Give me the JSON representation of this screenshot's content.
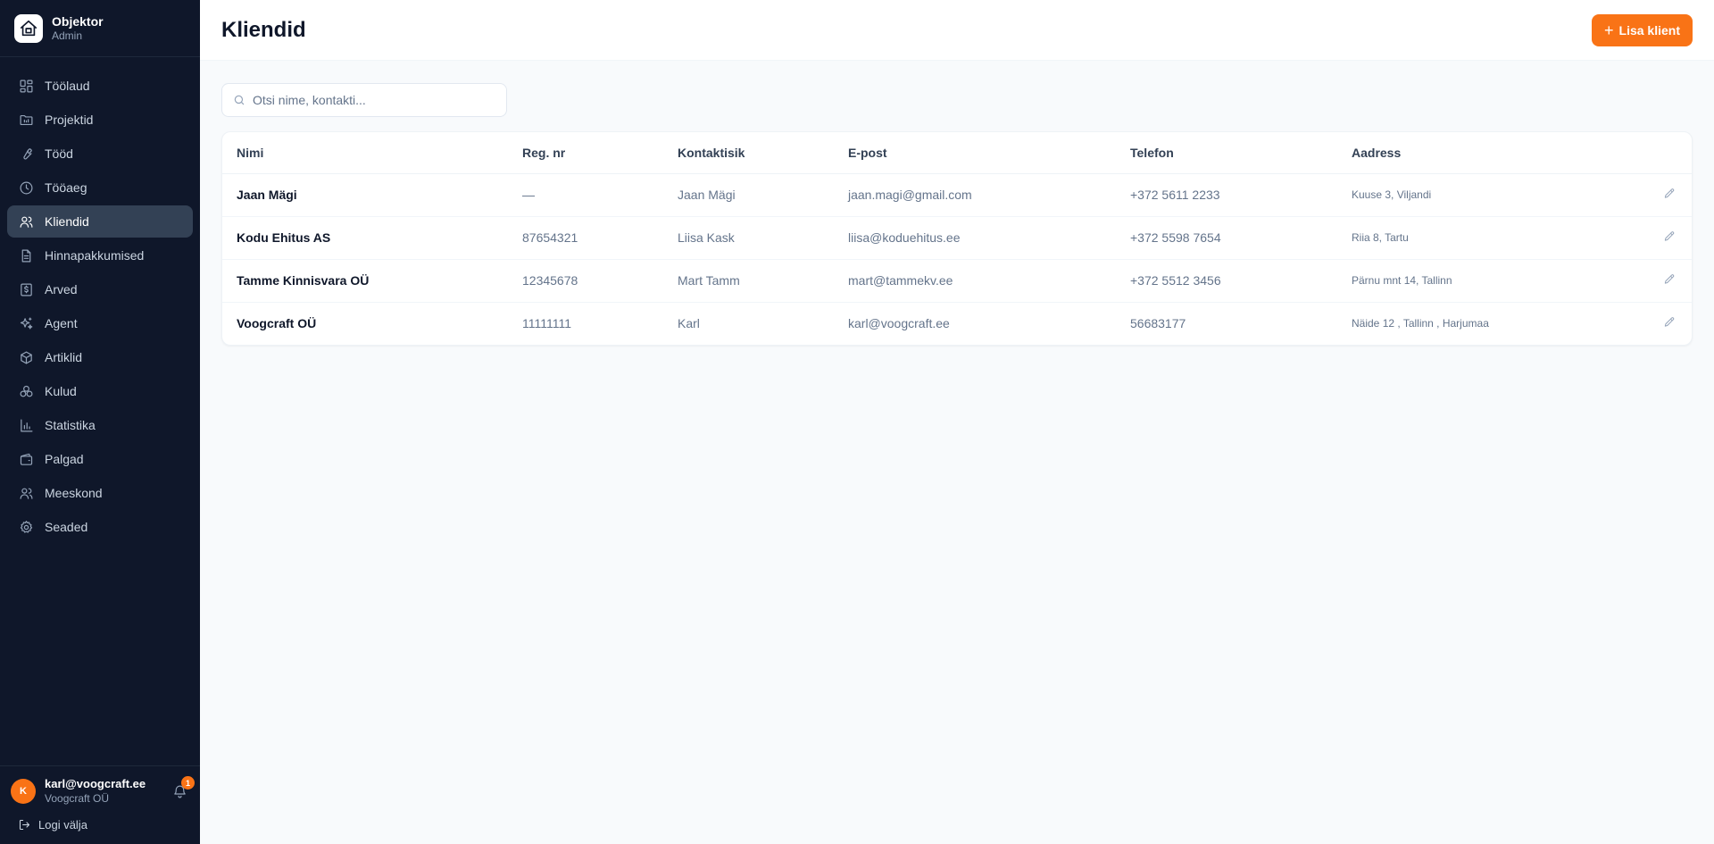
{
  "brand": {
    "name": "Objektor",
    "role": "Admin"
  },
  "nav": [
    {
      "label": "Töölaud",
      "icon": "dashboard-icon",
      "active": false
    },
    {
      "label": "Projektid",
      "icon": "folder-icon",
      "active": false
    },
    {
      "label": "Tööd",
      "icon": "wrench-icon",
      "active": false
    },
    {
      "label": "Tööaeg",
      "icon": "clock-icon",
      "active": false
    },
    {
      "label": "Kliendid",
      "icon": "users-icon",
      "active": true
    },
    {
      "label": "Hinnapakkumised",
      "icon": "document-icon",
      "active": false
    },
    {
      "label": "Arved",
      "icon": "invoice-icon",
      "active": false
    },
    {
      "label": "Agent",
      "icon": "sparkles-icon",
      "active": false
    },
    {
      "label": "Artiklid",
      "icon": "box-icon",
      "active": false
    },
    {
      "label": "Kulud",
      "icon": "coins-icon",
      "active": false
    },
    {
      "label": "Statistika",
      "icon": "bar-chart-icon",
      "active": false
    },
    {
      "label": "Palgad",
      "icon": "wallet-icon",
      "active": false
    },
    {
      "label": "Meeskond",
      "icon": "team-icon",
      "active": false
    },
    {
      "label": "Seaded",
      "icon": "gear-icon",
      "active": false
    }
  ],
  "user": {
    "initial": "K",
    "email": "karl@voogcraft.ee",
    "org": "Voogcraft OÜ",
    "notifications": "1"
  },
  "logout_label": "Logi välja",
  "page": {
    "title": "Kliendid",
    "add_label": "Lisa klient",
    "search_placeholder": "Otsi nime, kontakti..."
  },
  "table": {
    "headers": [
      "Nimi",
      "Reg. nr",
      "Kontaktisik",
      "E-post",
      "Telefon",
      "Aadress"
    ],
    "rows": [
      {
        "name": "Jaan Mägi",
        "reg": "—",
        "contact": "Jaan Mägi",
        "email": "jaan.magi@gmail.com",
        "phone": "+372 5611 2233",
        "address": "Kuuse 3, Viljandi"
      },
      {
        "name": "Kodu Ehitus AS",
        "reg": "87654321",
        "contact": "Liisa Kask",
        "email": "liisa@koduehitus.ee",
        "phone": "+372 5598 7654",
        "address": "Riia 8, Tartu"
      },
      {
        "name": "Tamme Kinnisvara OÜ",
        "reg": "12345678",
        "contact": "Mart Tamm",
        "email": "mart@tammekv.ee",
        "phone": "+372 5512 3456",
        "address": "Pärnu mnt 14, Tallinn"
      },
      {
        "name": "Voogcraft OÜ",
        "reg": "11111111",
        "contact": "Karl",
        "email": "karl@voogcraft.ee",
        "phone": "56683177",
        "address": "Näide 12 , Tallinn , Harjumaa"
      }
    ]
  },
  "colors": {
    "sidebar": "#0f172a",
    "accent": "#f97316",
    "active_nav": "#334155"
  }
}
